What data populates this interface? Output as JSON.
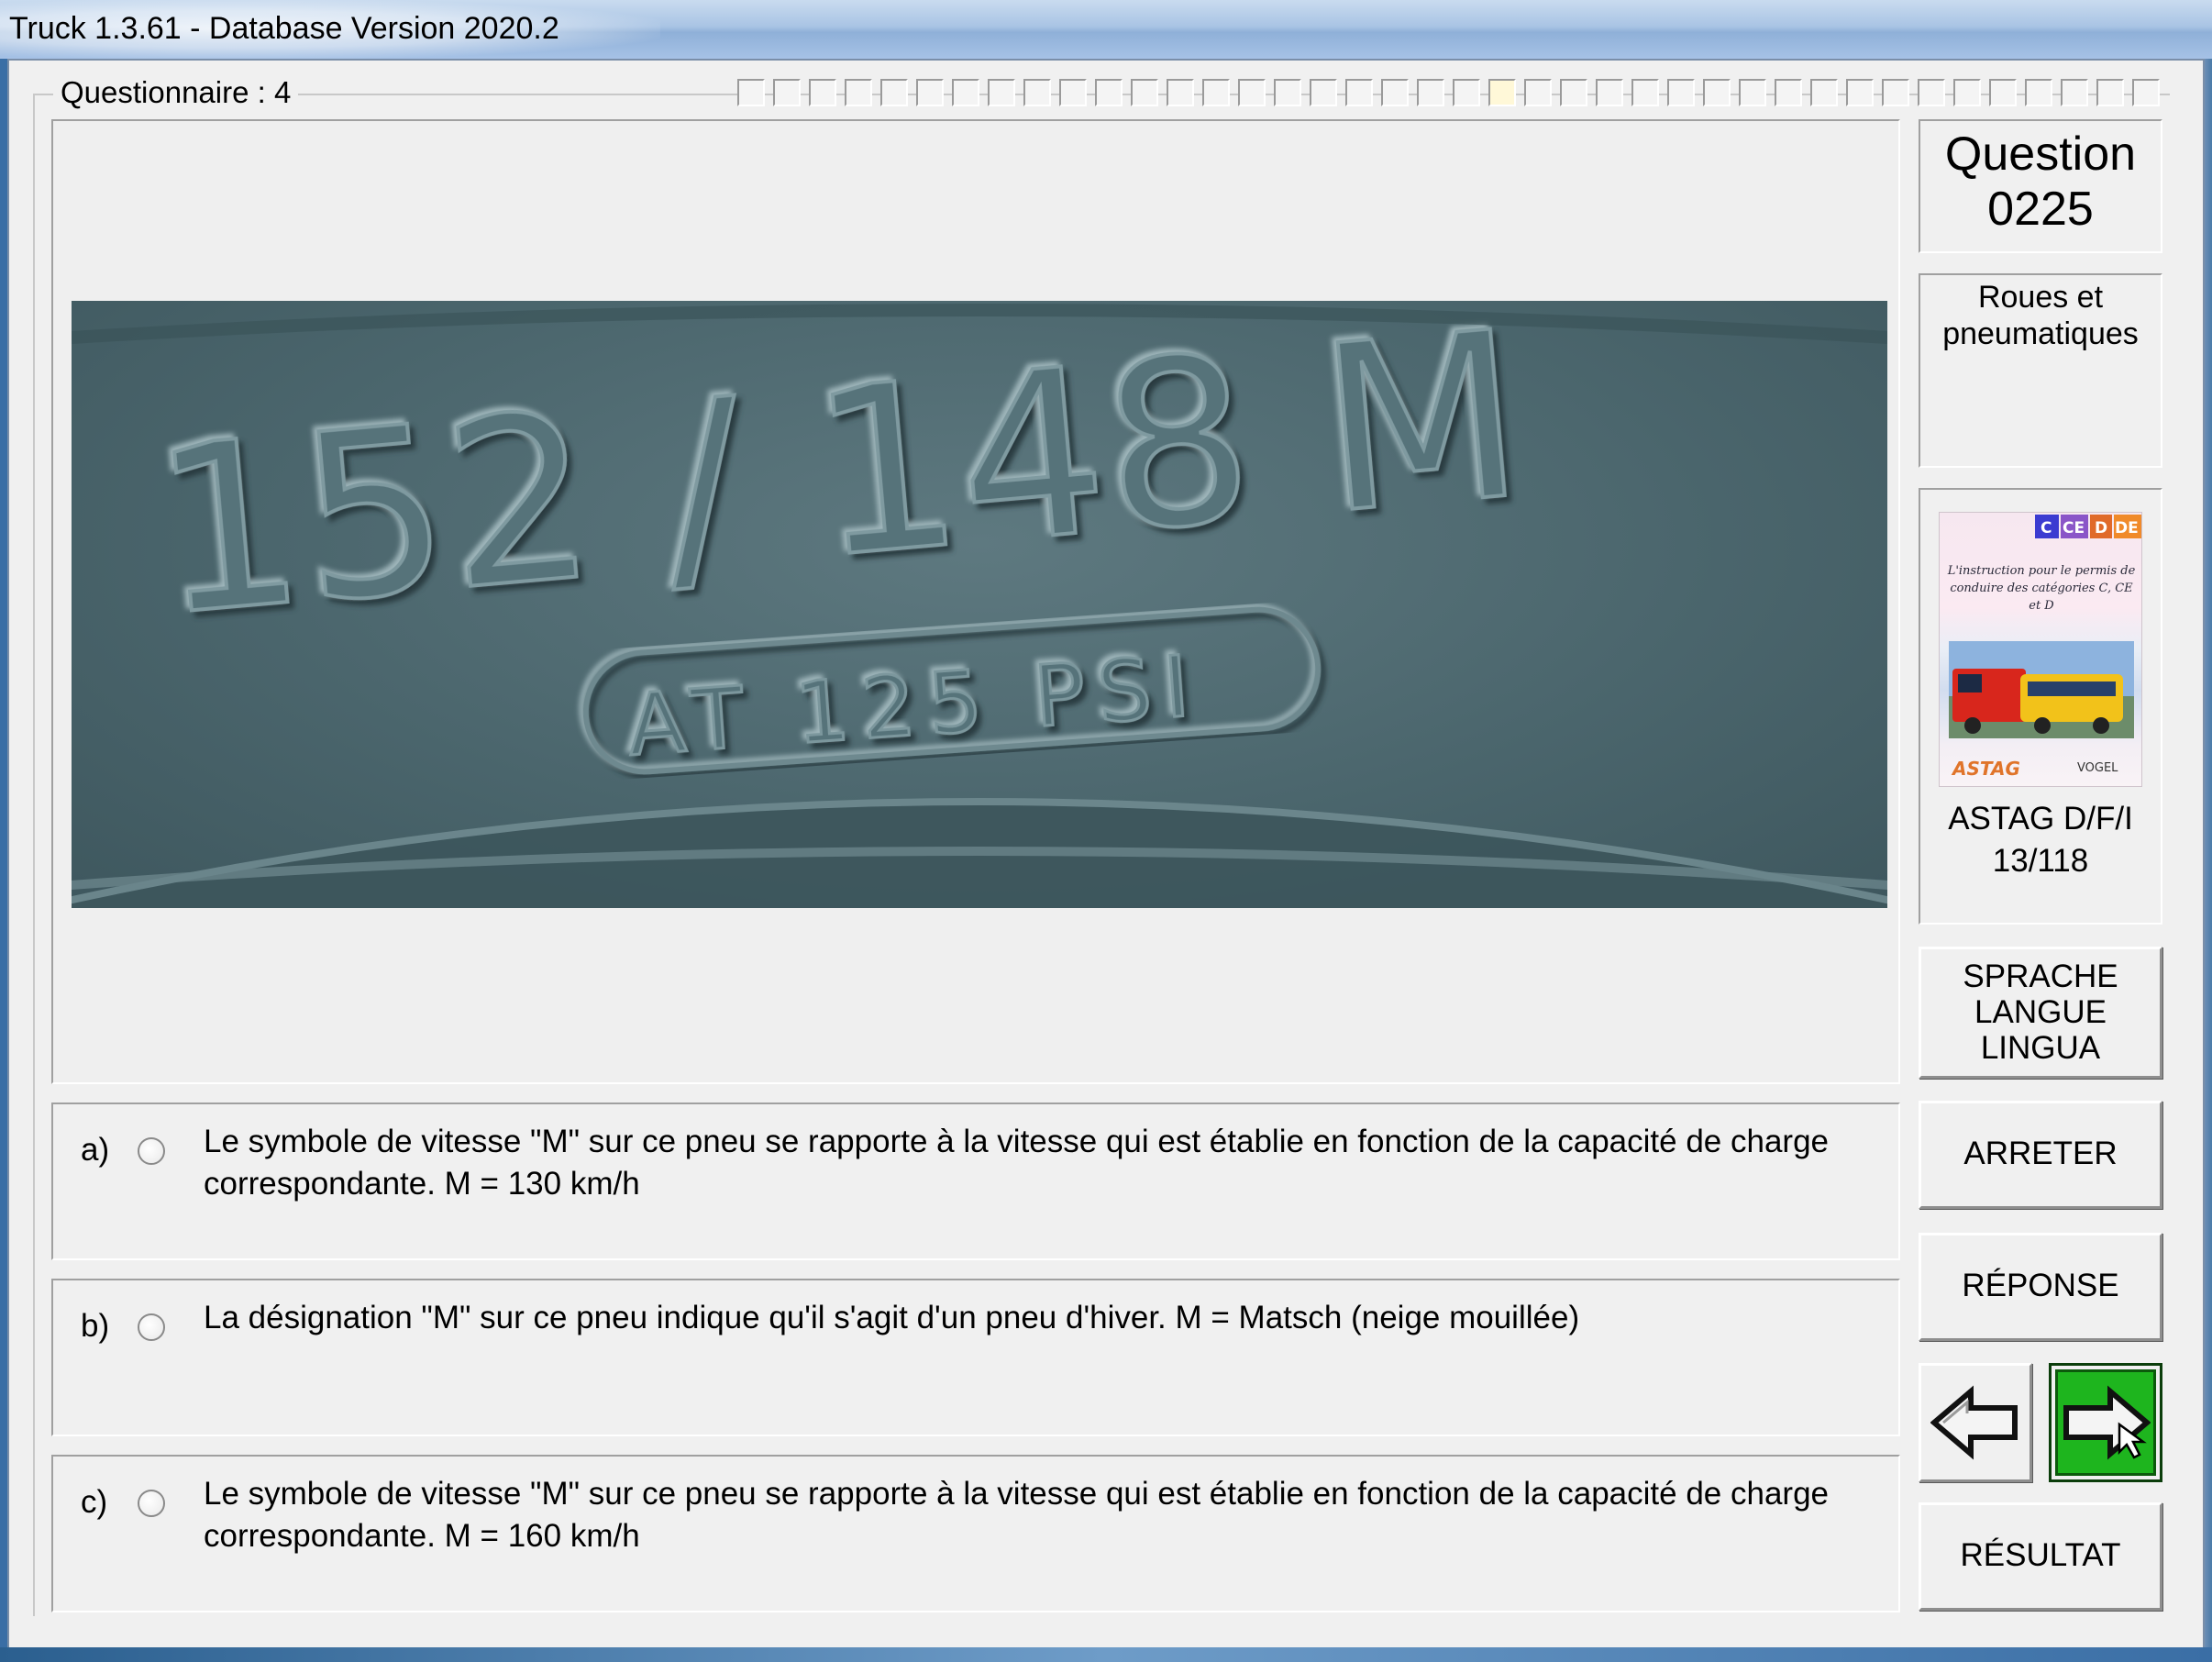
{
  "window": {
    "title": "Truck 1.3.61 - Database Version 2020.2"
  },
  "questionnaire": {
    "label": "Questionnaire : 4",
    "progress_segments": 40,
    "current_segment": 22
  },
  "question": {
    "title": "Question",
    "number": "0225",
    "category_line1": "Roues et",
    "category_line2": "pneumatiques"
  },
  "image": {
    "tire_text_main": "152 / 148 M",
    "tire_text_sub": "AT 125 PSI"
  },
  "answers": [
    {
      "letter": "a)",
      "text": "Le symbole de vitesse \"M\" sur ce pneu se rapporte à la vitesse qui est établie en fonction de la capacité de charge correspondante. M = 130 km/h"
    },
    {
      "letter": "b)",
      "text": "La désignation \"M\" sur ce pneu indique qu'il s'agit d'un pneu d'hiver. M = Matsch (neige mouillée)"
    },
    {
      "letter": "c)",
      "text": "Le symbole de vitesse \"M\" sur ce pneu se rapporte à la vitesse qui est établie en fonction de la capacité de charge correspondante. M = 160 km/h"
    }
  ],
  "book": {
    "badges": [
      "C",
      "CE",
      "D",
      "DE"
    ],
    "cover_text": "L'instruction pour le permis de conduire des catégories C, CE et D",
    "publisher_left": "ASTAG",
    "publisher_right": "VOGEL",
    "source_line1": "ASTAG D/F/I",
    "source_line2": "13/118"
  },
  "buttons": {
    "lang_line1": "SPRACHE",
    "lang_line2": "LANGUE",
    "lang_line3": "LINGUA",
    "stop": "ARRETER",
    "answer": "RÉPONSE",
    "result": "RÉSULTAT",
    "prev_icon": "arrow-left-icon",
    "next_icon": "arrow-right-icon"
  },
  "colors": {
    "next_button": "#1eb51e",
    "tire": "#4e6970"
  }
}
